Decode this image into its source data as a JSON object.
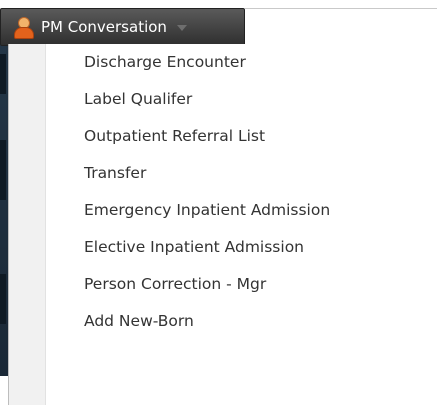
{
  "menu_button": {
    "label": "PM Conversation",
    "icon": "person-icon",
    "caret_icon": "chevron-down-icon"
  },
  "dropdown": {
    "items": [
      {
        "label": "Discharge Encounter"
      },
      {
        "label": "Label Qualifer"
      },
      {
        "label": "Outpatient Referral List"
      },
      {
        "label": "Transfer"
      },
      {
        "label": "Emergency Inpatient Admission"
      },
      {
        "label": "Elective Inpatient Admission"
      },
      {
        "label": "Person Correction - Mgr"
      },
      {
        "label": "Add New-Born"
      }
    ]
  },
  "colors": {
    "button_bg": "#3f3f3f",
    "menu_text": "#333333",
    "gutter": "#f1f1f1"
  }
}
